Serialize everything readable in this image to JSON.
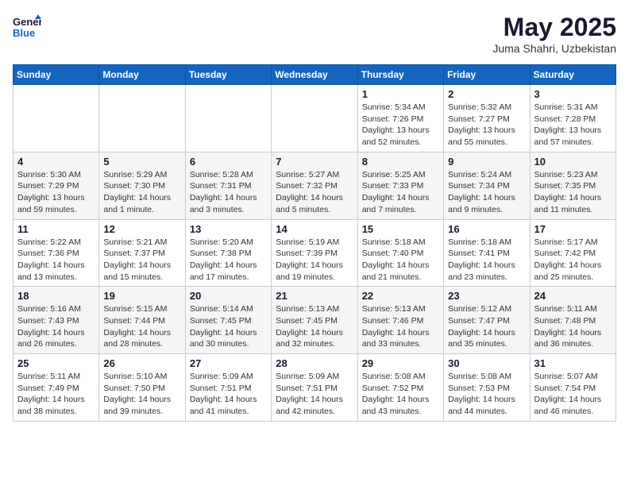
{
  "header": {
    "logo_line1": "General",
    "logo_line2": "Blue",
    "title": "May 2025",
    "subtitle": "Juma Shahri, Uzbekistan"
  },
  "weekdays": [
    "Sunday",
    "Monday",
    "Tuesday",
    "Wednesday",
    "Thursday",
    "Friday",
    "Saturday"
  ],
  "weeks": [
    [
      {
        "day": "",
        "info": ""
      },
      {
        "day": "",
        "info": ""
      },
      {
        "day": "",
        "info": ""
      },
      {
        "day": "",
        "info": ""
      },
      {
        "day": "1",
        "info": "Sunrise: 5:34 AM\nSunset: 7:26 PM\nDaylight: 13 hours\nand 52 minutes."
      },
      {
        "day": "2",
        "info": "Sunrise: 5:32 AM\nSunset: 7:27 PM\nDaylight: 13 hours\nand 55 minutes."
      },
      {
        "day": "3",
        "info": "Sunrise: 5:31 AM\nSunset: 7:28 PM\nDaylight: 13 hours\nand 57 minutes."
      }
    ],
    [
      {
        "day": "4",
        "info": "Sunrise: 5:30 AM\nSunset: 7:29 PM\nDaylight: 13 hours\nand 59 minutes."
      },
      {
        "day": "5",
        "info": "Sunrise: 5:29 AM\nSunset: 7:30 PM\nDaylight: 14 hours\nand 1 minute."
      },
      {
        "day": "6",
        "info": "Sunrise: 5:28 AM\nSunset: 7:31 PM\nDaylight: 14 hours\nand 3 minutes."
      },
      {
        "day": "7",
        "info": "Sunrise: 5:27 AM\nSunset: 7:32 PM\nDaylight: 14 hours\nand 5 minutes."
      },
      {
        "day": "8",
        "info": "Sunrise: 5:25 AM\nSunset: 7:33 PM\nDaylight: 14 hours\nand 7 minutes."
      },
      {
        "day": "9",
        "info": "Sunrise: 5:24 AM\nSunset: 7:34 PM\nDaylight: 14 hours\nand 9 minutes."
      },
      {
        "day": "10",
        "info": "Sunrise: 5:23 AM\nSunset: 7:35 PM\nDaylight: 14 hours\nand 11 minutes."
      }
    ],
    [
      {
        "day": "11",
        "info": "Sunrise: 5:22 AM\nSunset: 7:36 PM\nDaylight: 14 hours\nand 13 minutes."
      },
      {
        "day": "12",
        "info": "Sunrise: 5:21 AM\nSunset: 7:37 PM\nDaylight: 14 hours\nand 15 minutes."
      },
      {
        "day": "13",
        "info": "Sunrise: 5:20 AM\nSunset: 7:38 PM\nDaylight: 14 hours\nand 17 minutes."
      },
      {
        "day": "14",
        "info": "Sunrise: 5:19 AM\nSunset: 7:39 PM\nDaylight: 14 hours\nand 19 minutes."
      },
      {
        "day": "15",
        "info": "Sunrise: 5:18 AM\nSunset: 7:40 PM\nDaylight: 14 hours\nand 21 minutes."
      },
      {
        "day": "16",
        "info": "Sunrise: 5:18 AM\nSunset: 7:41 PM\nDaylight: 14 hours\nand 23 minutes."
      },
      {
        "day": "17",
        "info": "Sunrise: 5:17 AM\nSunset: 7:42 PM\nDaylight: 14 hours\nand 25 minutes."
      }
    ],
    [
      {
        "day": "18",
        "info": "Sunrise: 5:16 AM\nSunset: 7:43 PM\nDaylight: 14 hours\nand 26 minutes."
      },
      {
        "day": "19",
        "info": "Sunrise: 5:15 AM\nSunset: 7:44 PM\nDaylight: 14 hours\nand 28 minutes."
      },
      {
        "day": "20",
        "info": "Sunrise: 5:14 AM\nSunset: 7:45 PM\nDaylight: 14 hours\nand 30 minutes."
      },
      {
        "day": "21",
        "info": "Sunrise: 5:13 AM\nSunset: 7:45 PM\nDaylight: 14 hours\nand 32 minutes."
      },
      {
        "day": "22",
        "info": "Sunrise: 5:13 AM\nSunset: 7:46 PM\nDaylight: 14 hours\nand 33 minutes."
      },
      {
        "day": "23",
        "info": "Sunrise: 5:12 AM\nSunset: 7:47 PM\nDaylight: 14 hours\nand 35 minutes."
      },
      {
        "day": "24",
        "info": "Sunrise: 5:11 AM\nSunset: 7:48 PM\nDaylight: 14 hours\nand 36 minutes."
      }
    ],
    [
      {
        "day": "25",
        "info": "Sunrise: 5:11 AM\nSunset: 7:49 PM\nDaylight: 14 hours\nand 38 minutes."
      },
      {
        "day": "26",
        "info": "Sunrise: 5:10 AM\nSunset: 7:50 PM\nDaylight: 14 hours\nand 39 minutes."
      },
      {
        "day": "27",
        "info": "Sunrise: 5:09 AM\nSunset: 7:51 PM\nDaylight: 14 hours\nand 41 minutes."
      },
      {
        "day": "28",
        "info": "Sunrise: 5:09 AM\nSunset: 7:51 PM\nDaylight: 14 hours\nand 42 minutes."
      },
      {
        "day": "29",
        "info": "Sunrise: 5:08 AM\nSunset: 7:52 PM\nDaylight: 14 hours\nand 43 minutes."
      },
      {
        "day": "30",
        "info": "Sunrise: 5:08 AM\nSunset: 7:53 PM\nDaylight: 14 hours\nand 44 minutes."
      },
      {
        "day": "31",
        "info": "Sunrise: 5:07 AM\nSunset: 7:54 PM\nDaylight: 14 hours\nand 46 minutes."
      }
    ]
  ]
}
